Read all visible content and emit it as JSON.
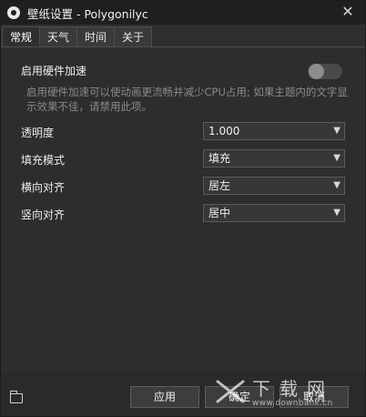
{
  "window": {
    "title": "壁纸设置 - Polygonilyc",
    "close_glyph": "✕"
  },
  "tabs": [
    {
      "label": "常规",
      "active": true
    },
    {
      "label": "天气",
      "active": false
    },
    {
      "label": "时间",
      "active": false
    },
    {
      "label": "关于",
      "active": false
    }
  ],
  "general": {
    "hw_accel": {
      "label": "启用硬件加速",
      "enabled": false,
      "description": "启用硬件加速可以使动画更流畅并减少CPU占用; 如果主题内的文字显示效果不佳，请禁用此项。"
    },
    "opacity": {
      "label": "透明度",
      "value": "1.000"
    },
    "fill_mode": {
      "label": "填充模式",
      "value": "填充"
    },
    "h_align": {
      "label": "横向对齐",
      "value": "居左"
    },
    "v_align": {
      "label": "竖向对齐",
      "value": "居中"
    }
  },
  "footer": {
    "apply_label": "应用",
    "ok_label": "确定",
    "cancel_label": "取消"
  },
  "watermark": {
    "title": "下载网",
    "url": "www.downbank.cn"
  },
  "icons": {
    "app": "gear-icon",
    "folder": "folder-icon",
    "dropdown": "chevron-down-icon"
  }
}
